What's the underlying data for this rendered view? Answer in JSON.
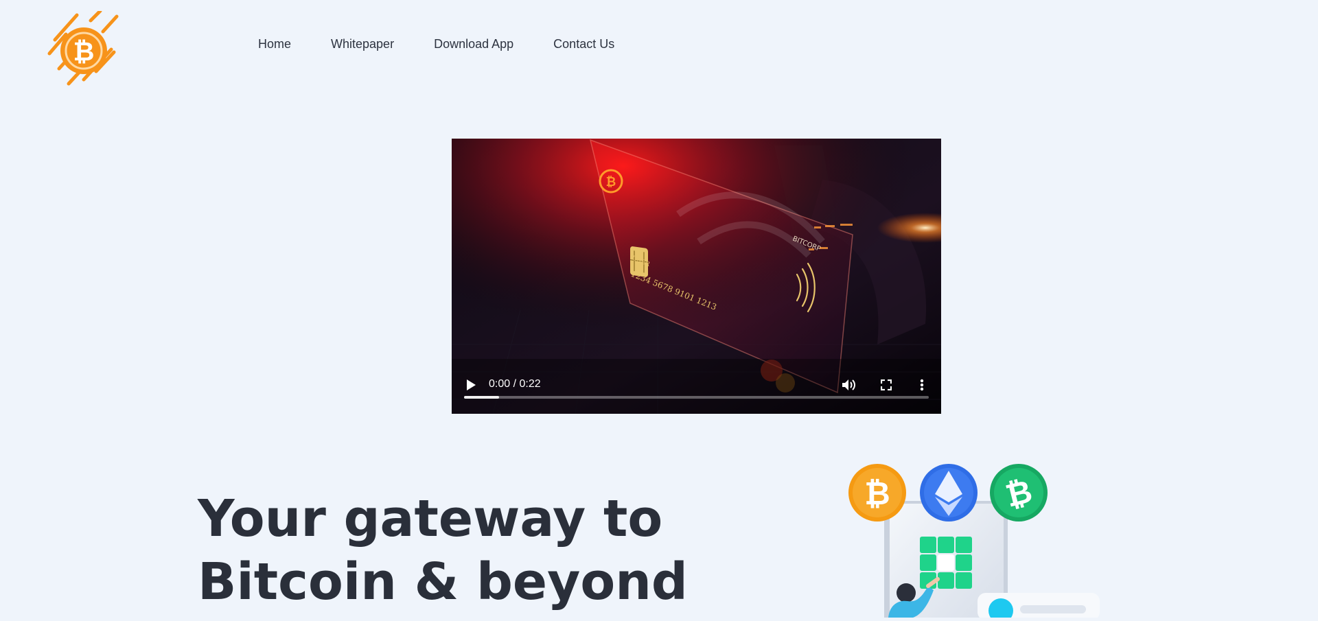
{
  "header": {
    "logo_icon": "bitcoin-circuit-logo",
    "nav": [
      {
        "label": "Home"
      },
      {
        "label": "Whitepaper"
      },
      {
        "label": "Download App"
      },
      {
        "label": "Contact Us"
      }
    ]
  },
  "video": {
    "time_display": "0:00 / 0:22",
    "progress": 0.075,
    "controls": [
      "play-icon",
      "volume-icon",
      "fullscreen-icon",
      "more-options-icon"
    ],
    "card": {
      "brand": "BITCORP",
      "holder": "USER",
      "number": "1234 5678 9101 1213"
    }
  },
  "hero": {
    "title_line1": "Your gateway to",
    "title_line2": "Bitcoin & beyond",
    "coins": [
      "bitcoin-coin-icon",
      "ethereum-coin-icon",
      "bitcoin-cash-coin-icon"
    ]
  },
  "colors": {
    "page_bg": "#eff4fb",
    "accent_orange": "#f7931a",
    "eth_blue": "#3d7bf0",
    "bch_green": "#1fbf73",
    "text_dark": "#2a2f3a"
  }
}
